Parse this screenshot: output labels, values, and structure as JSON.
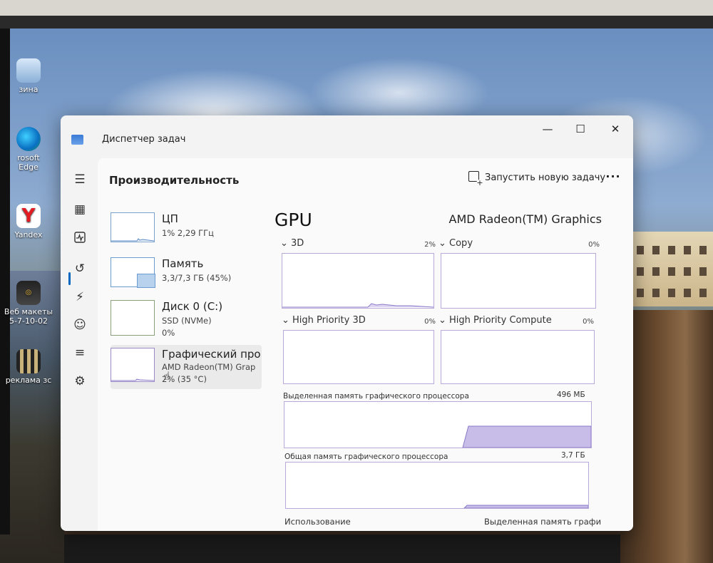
{
  "desktop": {
    "icons": [
      {
        "label": "зина",
        "icon": "recycle-bin-icon"
      },
      {
        "label": "rosoft\nEdge",
        "icon": "edge-icon"
      },
      {
        "label": "Yandex",
        "icon": "yandex-icon"
      },
      {
        "label": "Веб макеты\n5-7-10-02",
        "icon": "web-mockups-icon"
      },
      {
        "label": "реклама зс",
        "icon": "video-file-icon"
      }
    ]
  },
  "window": {
    "title": "Диспетчер задач",
    "controls": {
      "minimize": "—",
      "maximize": "☐",
      "close": "✕"
    }
  },
  "header": {
    "page_title": "Производительность",
    "run_new_task": "Запустить новую задачу",
    "more": "···"
  },
  "sidebar_cards": [
    {
      "name": "ЦП",
      "sub1": "1% 2,29 ГГц",
      "sub2": ""
    },
    {
      "name": "Память",
      "sub1": "3,3/7,3 ГБ (45%)",
      "sub2": ""
    },
    {
      "name": "Диск 0 (C:)",
      "sub1": "SSD (NVMe)",
      "sub2": "0%"
    },
    {
      "name": "Графический про",
      "sub1": "AMD Radeon(TM) Grap",
      "sub2": "2% (35 °C)"
    }
  ],
  "gpu": {
    "title": "GPU",
    "name": "AMD Radeon(TM) Graphics",
    "engines": [
      {
        "label": "3D",
        "pct": "2%"
      },
      {
        "label": "Copy",
        "pct": "0%"
      },
      {
        "label": "High Priority 3D",
        "pct": "0%"
      },
      {
        "label": "High Priority Compute",
        "pct": "0%"
      }
    ],
    "dedicated_label": "Выделенная память графического процессора",
    "dedicated_value": "496 МБ",
    "shared_label": "Общая память графического процессора",
    "shared_value": "3,7 ГБ",
    "footer_left": "Использование",
    "footer_right": "Выделенная память графи"
  },
  "colors": {
    "accent": "#0067c0",
    "graph_border": "#b9a9d8",
    "graph_fill": "#c7bde8"
  }
}
